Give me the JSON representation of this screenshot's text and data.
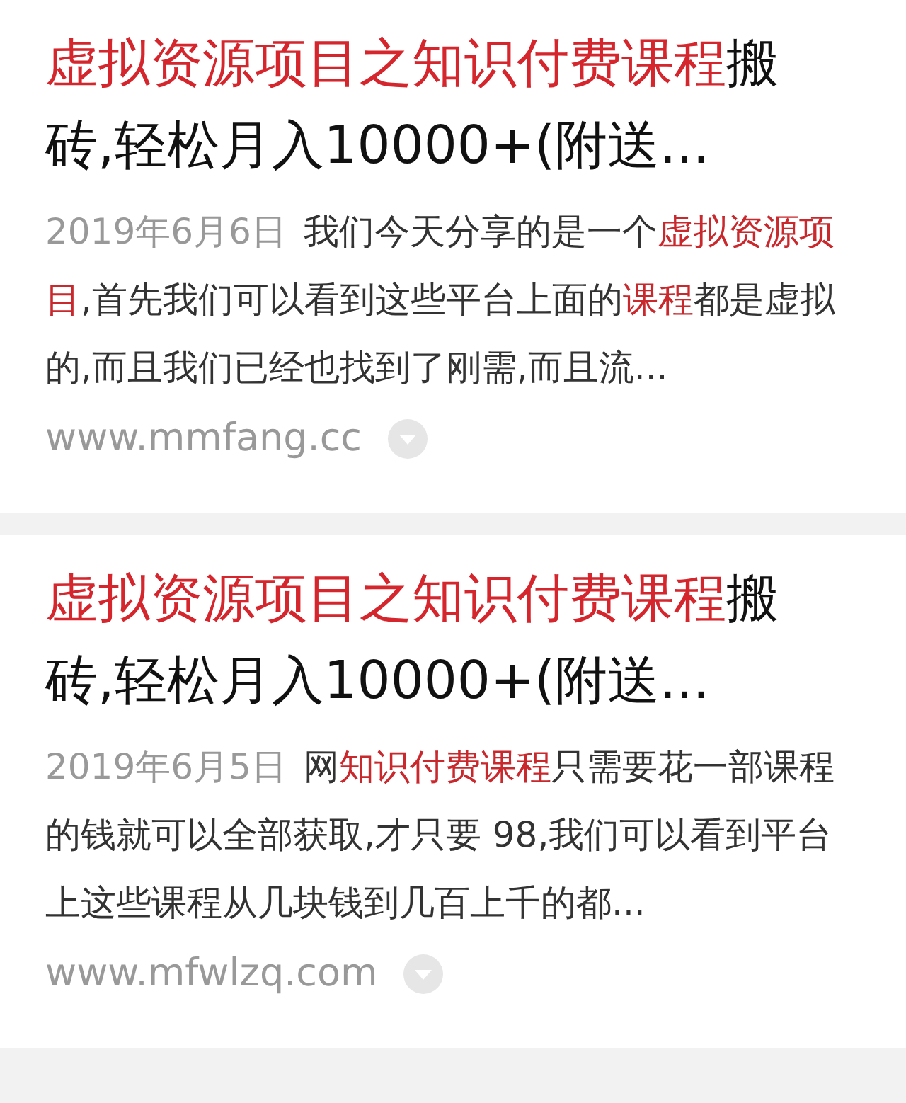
{
  "results": [
    {
      "title": "**虚拟资源项目之知识付费课程**搬砖,轻松月入10000+(附送...",
      "date": "2019年6月6日",
      "snippet": "我们今天分享的是一个**虚拟资源项目**,首先我们可以看到这些平台上面的**课程**都是虚拟的,而且我们已经也找到了刚需,而且流...",
      "url": "www.mmfang.cc"
    },
    {
      "title": "**虚拟资源项目之知识付费课程**搬砖,轻松月入10000+(附送...",
      "date": "2019年6月5日",
      "snippet": "网**知识付费课程**只需要花一部课程的钱就可以全部获取,才只要 98,我们可以看到平台上这些课程从几块钱到几百上千的都...",
      "url": "www.mfwlzq.com"
    }
  ]
}
